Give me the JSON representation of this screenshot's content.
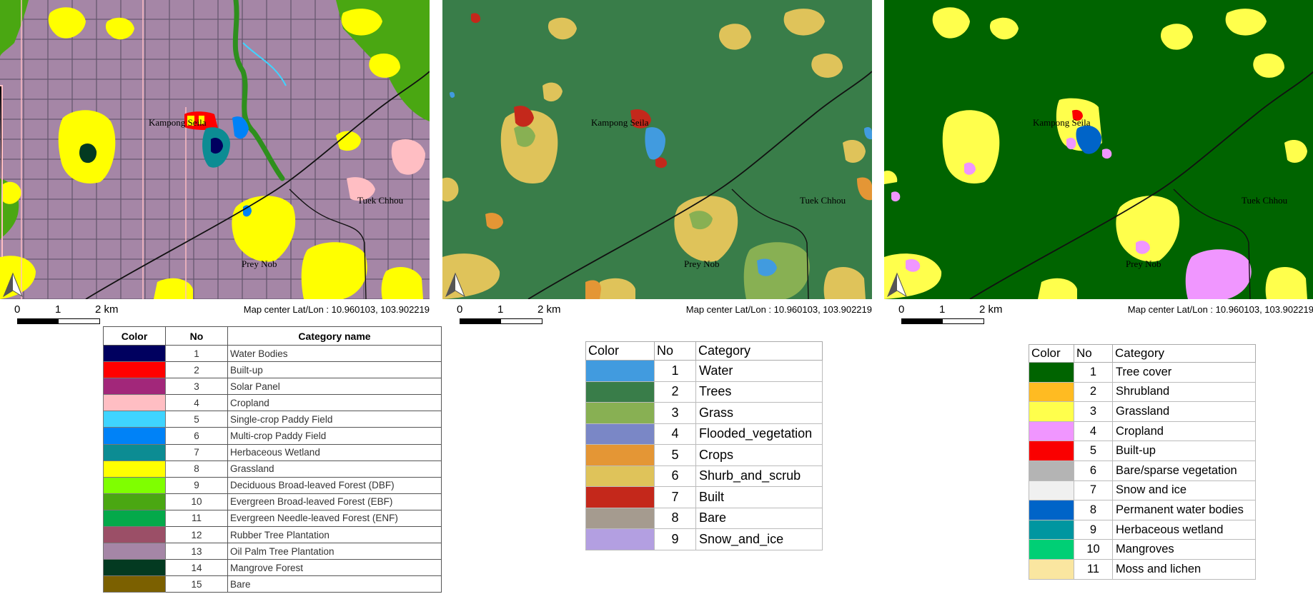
{
  "common": {
    "scale_labels": [
      "0",
      "1",
      "2 km"
    ],
    "map_center": "Map center Lat/Lon : 10.960103, 103.902219",
    "towns": {
      "kampong": "Kampong Seila",
      "tuek": "Tuek Chhou",
      "prey": "Prey Nob"
    },
    "north_arrow_icon": "north-arrow-icon"
  },
  "legend1": {
    "headers": [
      "Color",
      "No",
      "Category name"
    ],
    "rows": [
      {
        "no": "1",
        "name": "Water Bodies",
        "color": "#00005f"
      },
      {
        "no": "2",
        "name": "Built-up",
        "color": "#ff0000"
      },
      {
        "no": "3",
        "name": "Solar Panel",
        "color": "#a2277a"
      },
      {
        "no": "4",
        "name": "Cropland",
        "color": "#ffbec3"
      },
      {
        "no": "5",
        "name": "Single-crop Paddy Field",
        "color": "#3fd4ff"
      },
      {
        "no": "6",
        "name": "Multi-crop Paddy Field",
        "color": "#0082f7"
      },
      {
        "no": "7",
        "name": "Herbaceous Wetland",
        "color": "#0c8c93"
      },
      {
        "no": "8",
        "name": "Grassland",
        "color": "#ffff00"
      },
      {
        "no": "9",
        "name": "Deciduous Broad-leaved Forest (DBF)",
        "color": "#7fff00"
      },
      {
        "no": "10",
        "name": "Evergreen Broad-leaved Forest (EBF)",
        "color": "#4aa712"
      },
      {
        "no": "11",
        "name": "Evergreen Needle-leaved Forest (ENF)",
        "color": "#04a94a"
      },
      {
        "no": "12",
        "name": "Rubber Tree Plantation",
        "color": "#9b4f67"
      },
      {
        "no": "13",
        "name": "Oil Palm Tree Plantation",
        "color": "#a586a6"
      },
      {
        "no": "14",
        "name": "Mangrove Forest",
        "color": "#033a21"
      },
      {
        "no": "15",
        "name": "Bare",
        "color": "#7b6000"
      }
    ]
  },
  "legend2": {
    "headers": [
      "Color",
      "No",
      "Category"
    ],
    "rows": [
      {
        "no": "1",
        "name": "Water",
        "color": "#419bdf"
      },
      {
        "no": "2",
        "name": "Trees",
        "color": "#397d49"
      },
      {
        "no": "3",
        "name": "Grass",
        "color": "#88b053"
      },
      {
        "no": "4",
        "name": "Flooded_vegetation",
        "color": "#7a87c6"
      },
      {
        "no": "5",
        "name": "Crops",
        "color": "#e49635"
      },
      {
        "no": "6",
        "name": "Shurb_and_scrub",
        "color": "#dfc35a"
      },
      {
        "no": "7",
        "name": "Built",
        "color": "#c4281b"
      },
      {
        "no": "8",
        "name": "Bare",
        "color": "#a59b8f"
      },
      {
        "no": "9",
        "name": "Snow_and_ice",
        "color": "#b39fe1"
      }
    ]
  },
  "legend3": {
    "headers": [
      "Color",
      "No",
      "Category"
    ],
    "rows": [
      {
        "no": "1",
        "name": "Tree cover",
        "color": "#006400"
      },
      {
        "no": "2",
        "name": "Shrubland",
        "color": "#ffbb22"
      },
      {
        "no": "3",
        "name": "Grassland",
        "color": "#ffff4c"
      },
      {
        "no": "4",
        "name": "Cropland",
        "color": "#f096ff"
      },
      {
        "no": "5",
        "name": "Built-up",
        "color": "#fa0000"
      },
      {
        "no": "6",
        "name": "Bare/sparse vegetation",
        "color": "#b4b4b4"
      },
      {
        "no": "7",
        "name": "Snow and ice",
        "color": "#f0f0f0"
      },
      {
        "no": "8",
        "name": "Permanent water bodies",
        "color": "#0064c8"
      },
      {
        "no": "9",
        "name": "Herbaceous wetland",
        "color": "#0096a0"
      },
      {
        "no": "10",
        "name": "Mangroves",
        "color": "#00cf75"
      },
      {
        "no": "11",
        "name": "Moss and lichen",
        "color": "#fae6a0"
      }
    ]
  }
}
